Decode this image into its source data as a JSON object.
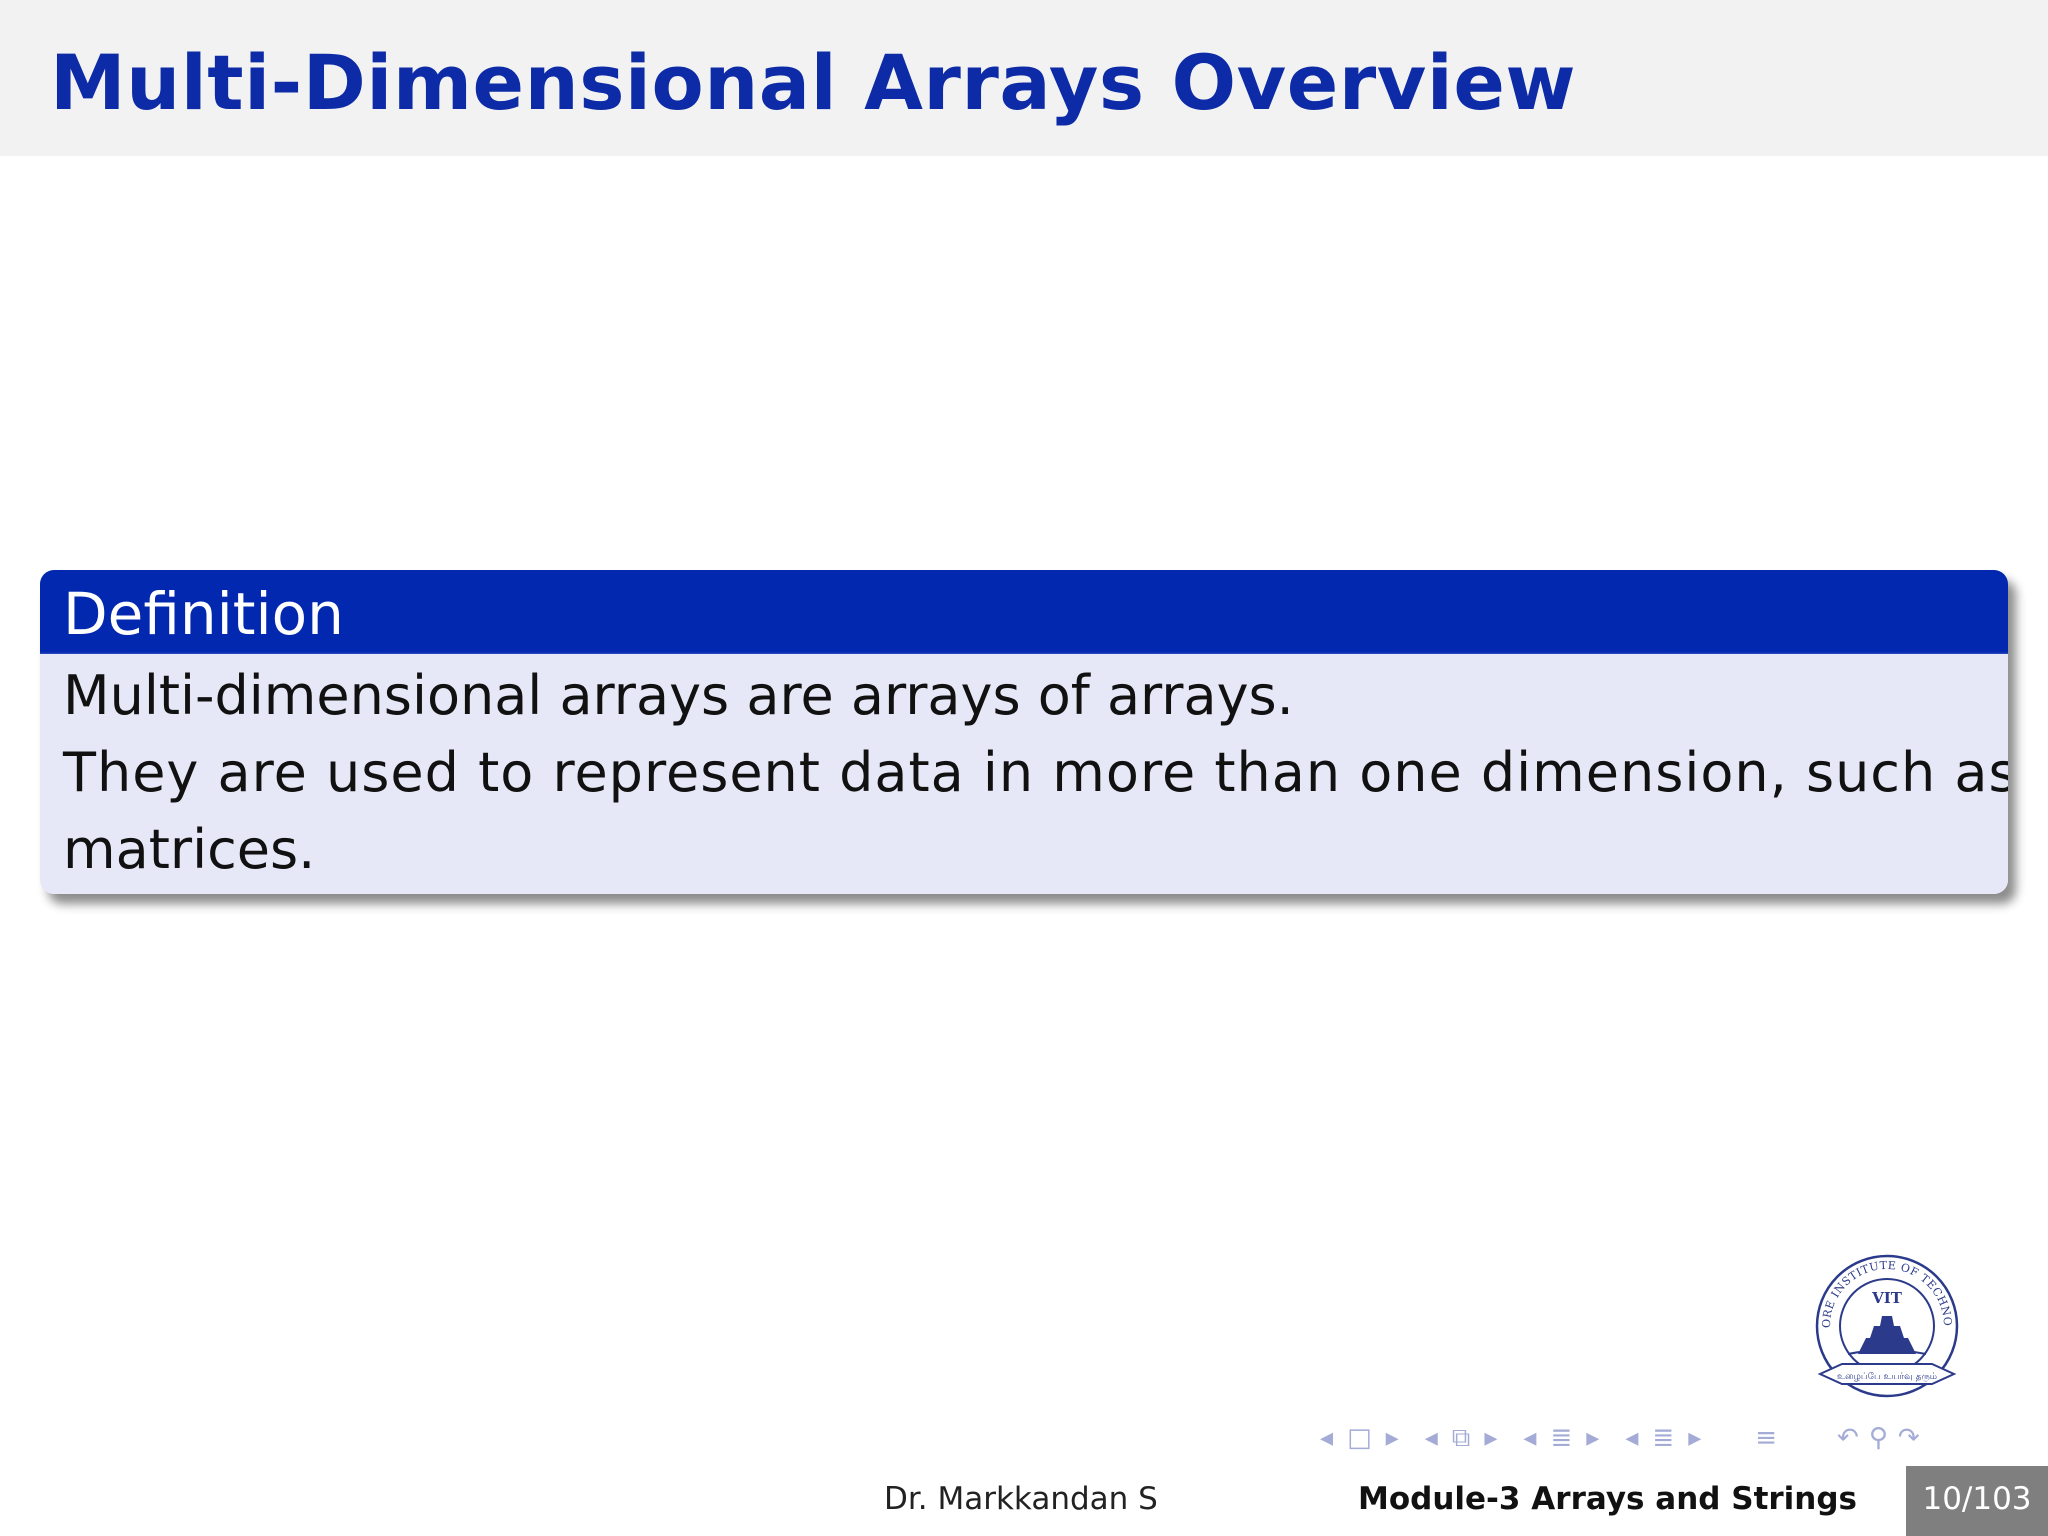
{
  "slide": {
    "title": "Multi-Dimensional Arrays Overview"
  },
  "definition": {
    "heading": "Definition",
    "lines": [
      "Multi-dimensional arrays are arrays of arrays.",
      "They are used to represent data in more than one dimension, such as",
      "matrices."
    ]
  },
  "logo": {
    "ring_text": "VELLORE INSTITUTE OF TECHNOLOGY",
    "center_text": "VIT",
    "motto": "உழைப்பே உயர்வு தரும்"
  },
  "footer": {
    "author": "Dr.  Markkandan S",
    "module": "Module-3  Arrays and Strings",
    "page": "10/103"
  },
  "colors": {
    "title": "#0d2ba6",
    "block_header": "#0328b0",
    "block_body": "#e6e8f7"
  }
}
